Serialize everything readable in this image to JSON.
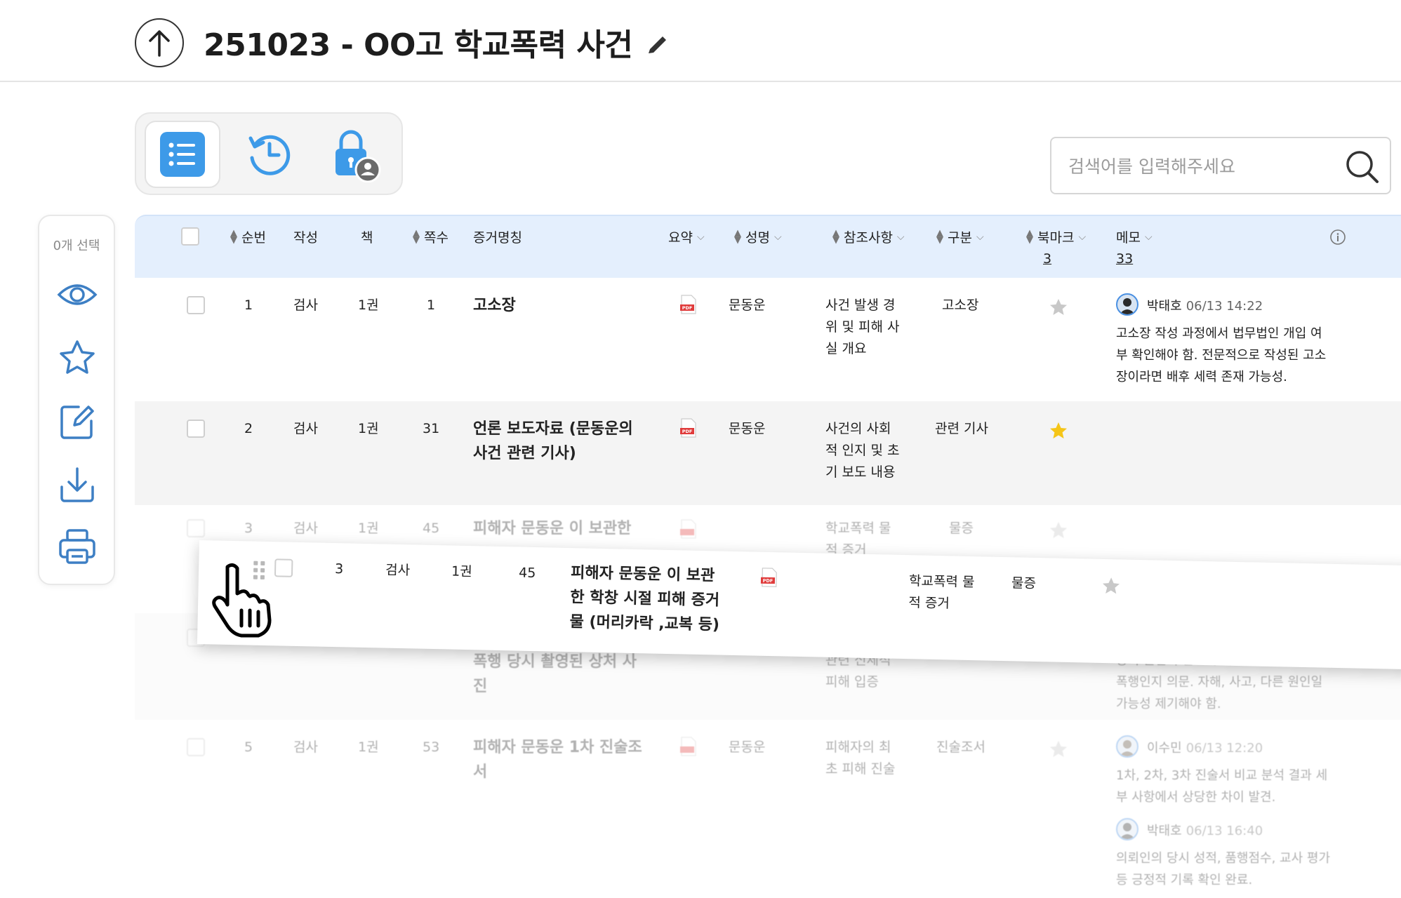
{
  "header": {
    "title": "251023 - OO고 학교폭력 사건"
  },
  "search": {
    "placeholder": "검색어를 입력해주세요"
  },
  "action_bar": {
    "selected_count": "0개 선택"
  },
  "table": {
    "columns": {
      "seq": "순번",
      "author": "작성",
      "book": "책",
      "page": "쪽수",
      "evidence": "증거명칭",
      "summary": "요약",
      "name": "성명",
      "reference": "참조사항",
      "category": "구분",
      "bookmark": "북마크",
      "memo": "메모"
    },
    "bookmark_count": "3",
    "memo_count": "33",
    "rows": [
      {
        "seq": "1",
        "author": "검사",
        "book": "1권",
        "page": "1",
        "evidence": "고소장",
        "name": "문동운",
        "reference": [
          "사건 발생 경",
          "위 및 피해 사",
          "실 개요"
        ],
        "category": "고소장",
        "bookmarked": false,
        "memo": {
          "user": "박태호",
          "time": "06/13 14:22",
          "lines": [
            "고소장 작성 과정에서 법무법인 개입 여",
            "부 확인해야 함. 전문적으로 작성된 고소",
            "장이라면 배후 세력 존재 가능성."
          ]
        }
      },
      {
        "seq": "2",
        "author": "검사",
        "book": "1권",
        "page": "31",
        "evidence": [
          "언론 보도자료 (문동운의",
          "사건 관련 기사)"
        ],
        "name": "문동운",
        "reference": [
          "사건의 사회",
          "적 인지 및 초",
          "기 보도 내용"
        ],
        "category": "관련 기사",
        "bookmarked": true
      },
      {
        "seq": "3",
        "author": "검사",
        "book": "1권",
        "page": "45",
        "evidence": "피해자 문동운 이 보관한",
        "reference": [
          "학교폭력 물",
          "적 증거"
        ],
        "category": "물증"
      },
      {
        "evidence": [
          "폭행 당시 촬영된 상처 사",
          "진"
        ],
        "reference": [
          "관련 신체적",
          "피해 입증"
        ],
        "memo_lines": [
          "상처 원인이 반드시 의뢰인 등에 의한",
          "폭행인지 의문. 자해, 사고, 다른 원인일",
          "가능성 제기해야 함."
        ]
      },
      {
        "seq": "5",
        "author": "검사",
        "book": "1권",
        "page": "53",
        "evidence": [
          "피해자 문동운 1차 진술조",
          "서"
        ],
        "name": "문동운",
        "reference": [
          "피해자의 최",
          "초 피해 진술"
        ],
        "category": "진술조서",
        "memo": {
          "user": "이수민",
          "time": "06/13 12:20",
          "lines": [
            "1차, 2차, 3차 진술서 비교 분석 결과 세",
            "부 사항에서 상당한 차이 발견."
          ]
        },
        "memo2": {
          "user": "박태호",
          "time": "06/13 16:40",
          "lines": [
            "의뢰인의 당시 성적, 품행점수, 교사 평가",
            "등 긍정적 기록 확인 완료."
          ]
        }
      }
    ],
    "dragged_row": {
      "seq": "3",
      "author": "검사",
      "book": "1권",
      "page": "45",
      "evidence": [
        "피해자 문동운 이 보관",
        "한 학창 시절 피해 증거",
        "물 (머리카락 ,교복 등)"
      ],
      "reference": [
        "학교폭력 물",
        "적 증거"
      ],
      "category": "물증"
    }
  },
  "colors": {
    "accent": "#3d9ae8",
    "header_bg": "#e4effd",
    "row_alt": "#f4f4f4",
    "star_active": "#f5c518",
    "pdf_red": "#e03b3b"
  }
}
